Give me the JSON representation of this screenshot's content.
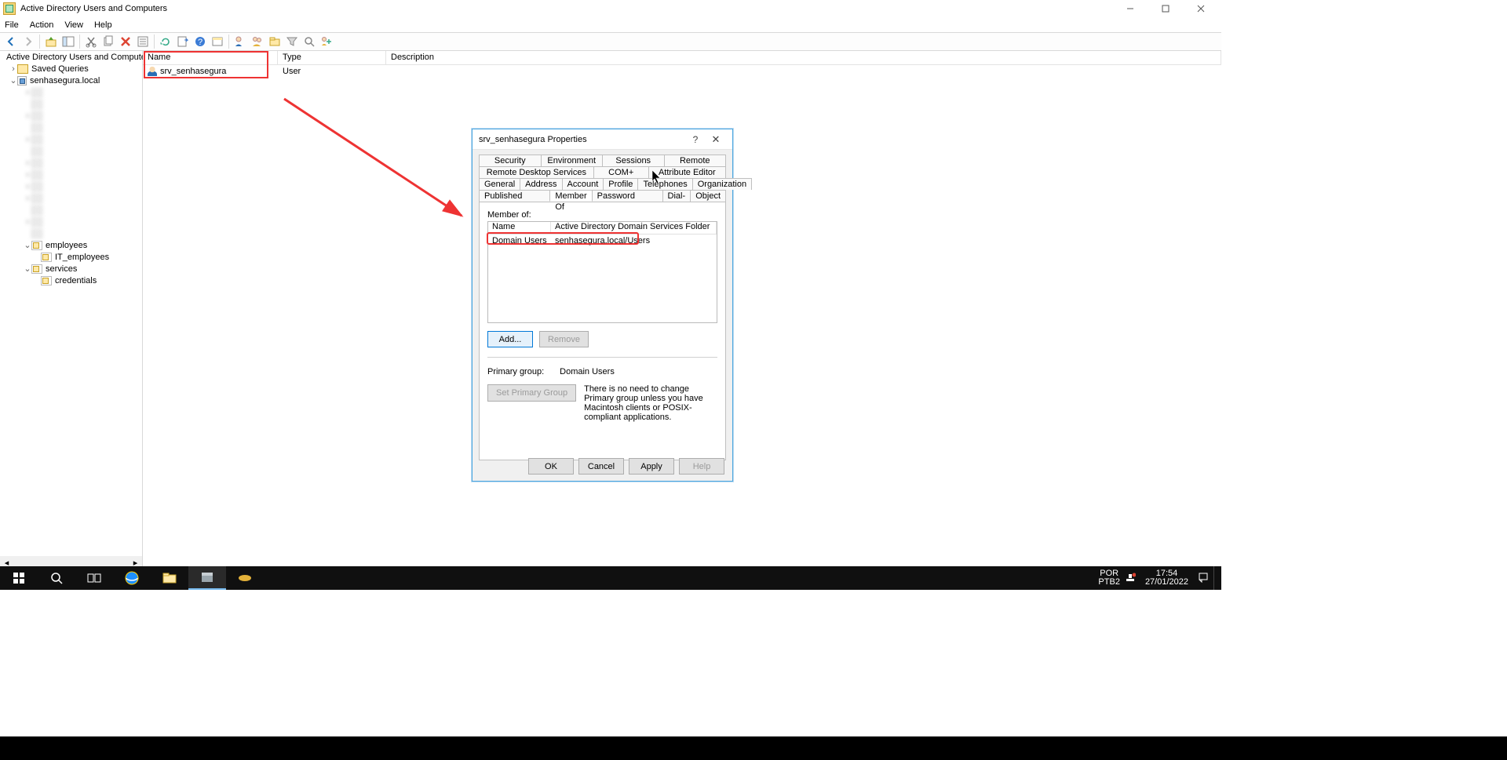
{
  "app": {
    "title": "Active Directory Users and Computers"
  },
  "menu": [
    "File",
    "Action",
    "View",
    "Help"
  ],
  "tree": {
    "root": "Active Directory Users and Computers",
    "savedQueries": "Saved Queries",
    "domain": "senhasegura.local",
    "employees": "employees",
    "itEmployees": "IT_employees",
    "services": "services",
    "credentials": "credentials"
  },
  "list": {
    "cols": {
      "name": "Name",
      "type": "Type",
      "desc": "Description"
    },
    "row": {
      "name": "srv_senhasegura",
      "type": "User"
    }
  },
  "dialog": {
    "title": "srv_senhasegura Properties",
    "tabs_row1": [
      "Security",
      "Environment",
      "Sessions",
      "Remote control"
    ],
    "tabs_row2": [
      "Remote Desktop Services Profile",
      "COM+",
      "Attribute Editor"
    ],
    "tabs_row3": [
      "General",
      "Address",
      "Account",
      "Profile",
      "Telephones",
      "Organization"
    ],
    "tabs_row4": [
      "Published Certificates",
      "Member Of",
      "Password Replication",
      "Dial-in",
      "Object"
    ],
    "memberOfLabel": "Member of:",
    "listCols": {
      "name": "Name",
      "folder": "Active Directory Domain Services Folder"
    },
    "listRow": {
      "name": "Domain Users",
      "folder": "senhasegura.local/Users"
    },
    "addBtn": "Add...",
    "removeBtn": "Remove",
    "primaryGroupLabel": "Primary group:",
    "primaryGroupValue": "Domain Users",
    "setPrimaryBtn": "Set Primary Group",
    "note": "There is no need to change Primary group unless you have Macintosh clients or POSIX-compliant applications.",
    "ok": "OK",
    "cancel": "Cancel",
    "apply": "Apply",
    "help": "Help"
  },
  "taskbar": {
    "lang": "POR",
    "kbd": "PTB2",
    "time": "17:54",
    "date": "27/01/2022"
  }
}
